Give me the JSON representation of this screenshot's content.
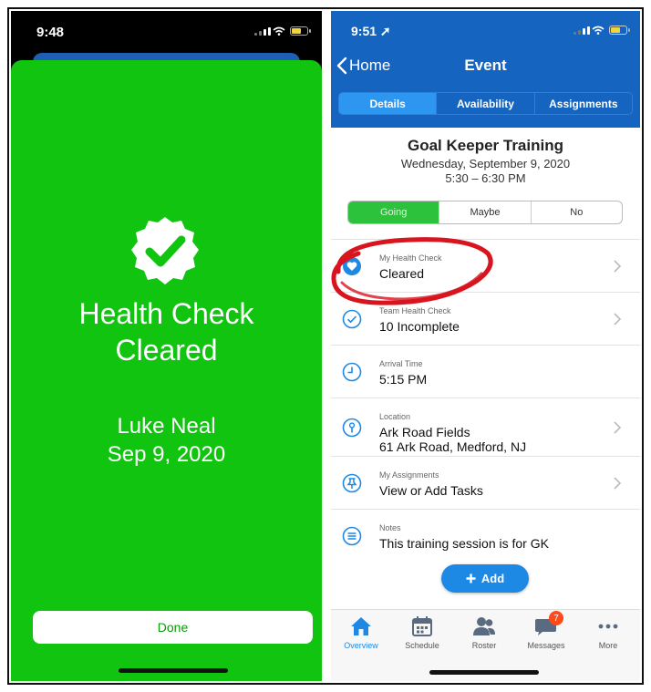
{
  "left_screen": {
    "status": {
      "time": "9:48"
    },
    "health_check": {
      "title_line1": "Health Check",
      "title_line2": "Cleared",
      "name": "Luke Neal",
      "date": "Sep 9, 2020"
    },
    "done_label": "Done",
    "colors": {
      "background": "#10c40f"
    }
  },
  "right_screen": {
    "status": {
      "time": "9:51"
    },
    "nav": {
      "back_label": "Home",
      "title": "Event"
    },
    "tabs": [
      {
        "label": "Details",
        "active": true
      },
      {
        "label": "Availability",
        "active": false
      },
      {
        "label": "Assignments",
        "active": false
      }
    ],
    "event": {
      "title": "Goal Keeper Training",
      "date": "Wednesday, September 9, 2020",
      "time": "5:30 – 6:30 PM"
    },
    "rsvp": [
      {
        "label": "Going",
        "selected": true
      },
      {
        "label": "Maybe",
        "selected": false
      },
      {
        "label": "No",
        "selected": false
      }
    ],
    "rows": [
      {
        "label": "My Health Check",
        "value": "Cleared",
        "icon": "heart-icon"
      },
      {
        "label": "Team Health Check",
        "value": "10 Incomplete",
        "icon": "check-circle-icon"
      },
      {
        "label": "Arrival Time",
        "value": "5:15 PM",
        "icon": "clock-icon"
      },
      {
        "label": "Location",
        "value": "Ark Road Fields",
        "value2": "61 Ark Road, Medford, NJ",
        "icon": "location-pin-icon"
      },
      {
        "label": "My Assignments",
        "value": "View or Add Tasks",
        "icon": "pushpin-icon"
      },
      {
        "label": "Notes",
        "value": "This training session is for GK",
        "icon": "notes-icon"
      }
    ],
    "add_label": "Add",
    "tabbar": [
      {
        "label": "Overview",
        "active": true
      },
      {
        "label": "Schedule",
        "active": false
      },
      {
        "label": "Roster",
        "active": false
      },
      {
        "label": "Messages",
        "active": false,
        "badge": "7"
      },
      {
        "label": "More",
        "active": false
      }
    ],
    "colors": {
      "header": "#1565c0",
      "accent": "#1e88e5",
      "going": "#2cc23b",
      "annotation": "#d8141e"
    }
  }
}
